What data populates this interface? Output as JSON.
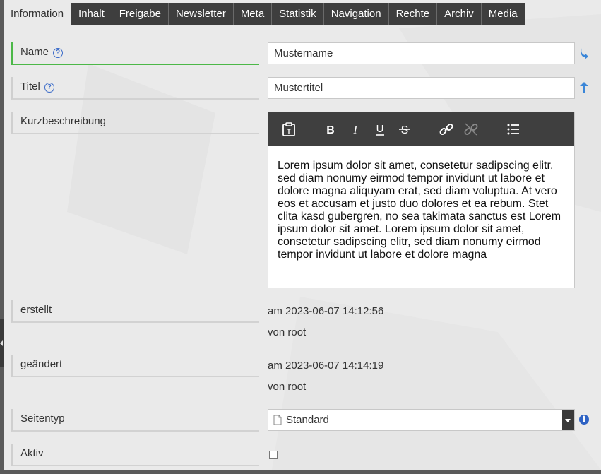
{
  "tabs": [
    {
      "label": "Information",
      "active": true
    },
    {
      "label": "Inhalt"
    },
    {
      "label": "Freigabe"
    },
    {
      "label": "Newsletter"
    },
    {
      "label": "Meta"
    },
    {
      "label": "Statistik"
    },
    {
      "label": "Navigation"
    },
    {
      "label": "Rechte"
    },
    {
      "label": "Archiv"
    },
    {
      "label": "Media"
    }
  ],
  "fields": {
    "name": {
      "label": "Name",
      "value": "Mustername",
      "help": "?"
    },
    "titel": {
      "label": "Titel",
      "value": "Mustertitel",
      "help": "?"
    },
    "kurzbeschreibung": {
      "label": "Kurzbeschreibung",
      "text": "Lorem ipsum dolor sit amet, consetetur sadipscing elitr, sed diam nonumy eirmod tempor invidunt ut labore et dolore magna aliquyam erat, sed diam voluptua. At vero eos et accusam et justo duo dolores et ea rebum. Stet clita kasd gubergren, no sea takimata sanctus est Lorem ipsum dolor sit amet. Lorem ipsum dolor sit amet, consetetur sadipscing elitr, sed diam nonumy eirmod tempor invidunt ut labore et dolore magna"
    },
    "erstellt": {
      "label": "erstellt",
      "date": "am 2023-06-07 14:12:56",
      "by": "von root"
    },
    "geaendert": {
      "label": "geändert",
      "date": "am 2023-06-07 14:14:19",
      "by": "von root"
    },
    "seitentyp": {
      "label": "Seitentyp",
      "value": "Standard",
      "info": "i"
    },
    "aktiv": {
      "label": "Aktiv",
      "checked": false
    }
  },
  "toolbar_icons": [
    "paste-icon",
    "bold-icon",
    "italic-icon",
    "underline-icon",
    "strikethrough-icon",
    "link-icon",
    "unlink-icon",
    "bullet-list-icon"
  ],
  "colors": {
    "required": "#4cb848",
    "tab_bg": "#3e3e3e",
    "toolbar_bg": "#3f3f3f",
    "accent_blue": "#2f63c4"
  }
}
